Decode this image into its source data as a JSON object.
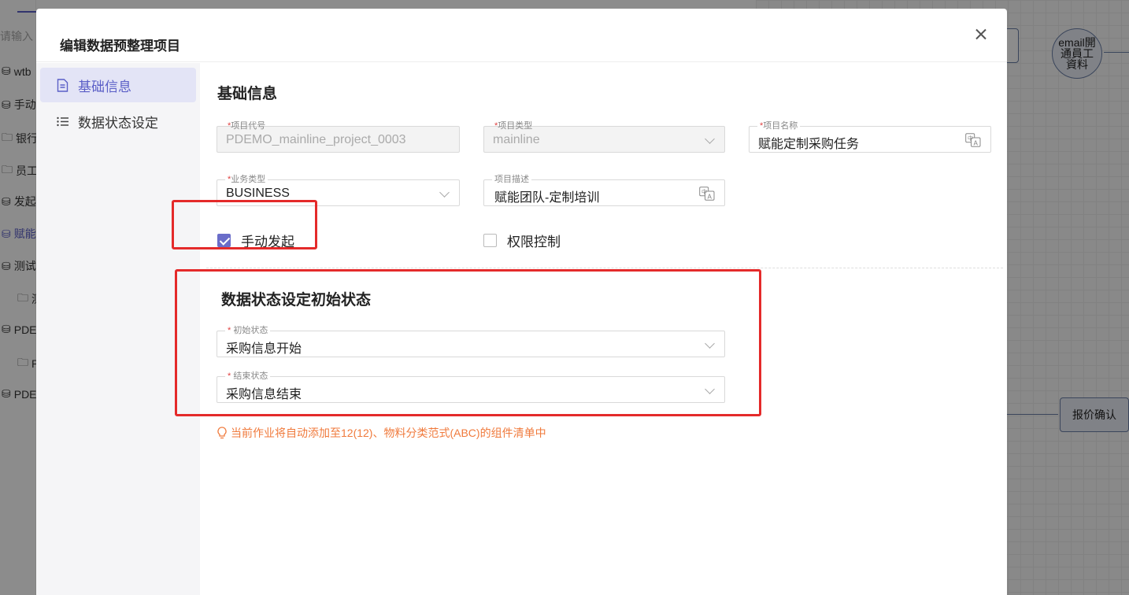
{
  "background": {
    "search_placeholder": "请输入",
    "tree_items": [
      "wtb",
      "手动",
      "银行",
      "员工",
      "发起",
      "赋能",
      "测试",
      "测",
      "PDE",
      "P",
      "PDE"
    ],
    "canvas_nodes": {
      "circle_label": "email開通員工資料",
      "quote_label": "报价确认"
    }
  },
  "modal": {
    "title": "编辑数据预整理项目",
    "nav": [
      {
        "label": "基础信息",
        "icon": "document-icon"
      },
      {
        "label": "数据状态设定",
        "icon": "list-icon"
      }
    ],
    "basic": {
      "section_title": "基础信息",
      "project_code": {
        "label": "项目代号",
        "value": "PDEMO_mainline_project_0003"
      },
      "project_type": {
        "label": "项目类型",
        "value": "mainline"
      },
      "project_name": {
        "label": "项目名称",
        "value": "赋能定制采购任务"
      },
      "business_type": {
        "label": "业务类型",
        "value": "BUSINESS"
      },
      "project_desc": {
        "label": "项目描述",
        "value": "赋能团队-定制培训"
      },
      "manual_start": {
        "label": "手动发起",
        "checked": true
      },
      "permission_control": {
        "label": "权限控制",
        "checked": false
      }
    },
    "status": {
      "section_title": "数据状态设定初始状态",
      "initial_state": {
        "label": "初始状态",
        "value": "采购信息开始"
      },
      "end_state": {
        "label": "结束状态",
        "value": "采购信息结束"
      }
    },
    "hint": "当前作业将自动添加至12(12)、物料分类范式(ABC)的组件清单中",
    "colors": {
      "accent": "#5b5fc7",
      "highlight": "#e42a2a",
      "hint": "#f07a3c"
    }
  }
}
